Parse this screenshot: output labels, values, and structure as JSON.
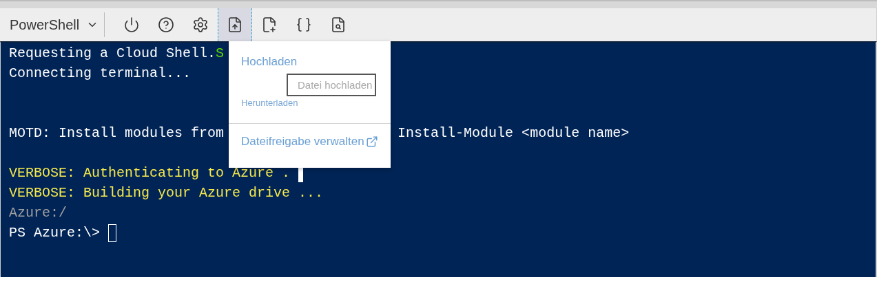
{
  "toolbar": {
    "shell_selector": {
      "label": "PowerShell"
    },
    "buttons": [
      {
        "kind": "power",
        "selected": false
      },
      {
        "kind": "help",
        "selected": false
      },
      {
        "kind": "settings",
        "selected": false
      },
      {
        "kind": "upload-download",
        "selected": true
      },
      {
        "kind": "new-file",
        "selected": false
      },
      {
        "kind": "braces",
        "selected": false
      },
      {
        "kind": "file-search",
        "selected": false
      }
    ]
  },
  "terminal": {
    "blocks": [
      {
        "lines": [
          {
            "segments": [
              {
                "text": "Requesting a Cloud Shell.",
                "color": "#ffffff"
              },
              {
                "text": "S",
                "color": "#5fd700"
              }
            ]
          },
          {
            "segments": [
              {
                "text": "Connecting terminal...",
                "color": "#ffffff"
              }
            ]
          }
        ]
      },
      {
        "lines": [
          {
            "segments": [
              {
                "text": "MOTD: Install modules from",
                "color": "#ffffff"
              },
              {
                "text": "Install-Module <module name>",
                "color": "#ffffff",
                "kind": "after_menu"
              }
            ]
          }
        ]
      },
      {
        "lines": [
          {
            "segments": [
              {
                "text": "VERBOSE: Authenticating to Azure .",
                "color": "#f5e84c"
              }
            ],
            "cursor": true
          },
          {
            "segments": [
              {
                "text": "VERBOSE: Building your Azure drive ...",
                "color": "#f5e84c"
              }
            ]
          },
          {
            "segments": [
              {
                "text": "Azure:/",
                "color": "#a0a0a0"
              }
            ]
          },
          {
            "segments": [
              {
                "text": "PS Azure:\\>",
                "color": "#ffffff"
              }
            ],
            "prompt": true
          }
        ]
      }
    ]
  },
  "menu": {
    "items": [
      {
        "kind": "large",
        "label": "Hochladen"
      },
      {
        "kind": "tooltip",
        "label": "Datei hochladen"
      },
      {
        "kind": "small",
        "label": "Herunterladen"
      },
      {
        "kind": "divider"
      },
      {
        "kind": "external",
        "label": "Dateifreigabe verwalten"
      }
    ]
  }
}
